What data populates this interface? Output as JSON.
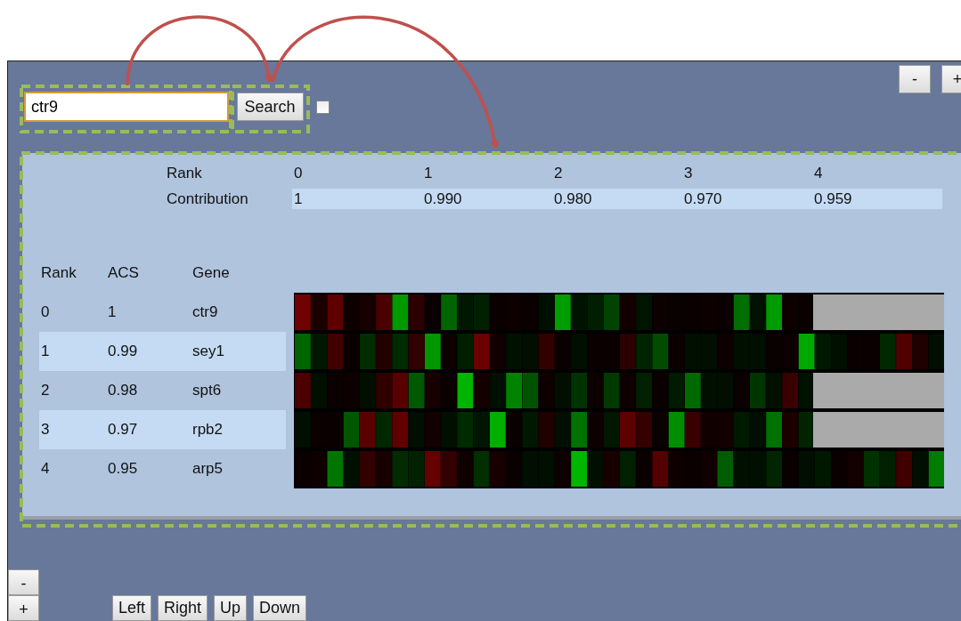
{
  "search": {
    "value": "ctr9"
  },
  "search_button": "Search",
  "checkbox": {
    "checked": false
  },
  "zoom_buttons": [
    "-",
    "+"
  ],
  "contribution": {
    "rank_label": "Rank",
    "contribution_label": "Contribution",
    "columns": [
      {
        "rank": "0",
        "contribution": "1"
      },
      {
        "rank": "1",
        "contribution": "0.990"
      },
      {
        "rank": "2",
        "contribution": "0.980"
      },
      {
        "rank": "3",
        "contribution": "0.970"
      },
      {
        "rank": "4",
        "contribution": "0.959"
      }
    ]
  },
  "genes": {
    "columns": [
      "Rank",
      "ACS",
      "Gene"
    ],
    "rows": [
      {
        "rank": "0",
        "acs": "1",
        "gene": "ctr9",
        "no_data_tail": true
      },
      {
        "rank": "1",
        "acs": "0.99",
        "gene": "sey1",
        "no_data_tail": false
      },
      {
        "rank": "2",
        "acs": "0.98",
        "gene": "spt6",
        "no_data_tail": true
      },
      {
        "rank": "3",
        "acs": "0.97",
        "gene": "rpb2",
        "no_data_tail": true
      },
      {
        "rank": "4",
        "acs": "0.95",
        "gene": "arp5",
        "no_data_tail": false
      }
    ]
  },
  "side_zoom_buttons": [
    "-",
    "+"
  ],
  "nav_buttons": [
    "Left",
    "Right",
    "Up",
    "Down"
  ]
}
